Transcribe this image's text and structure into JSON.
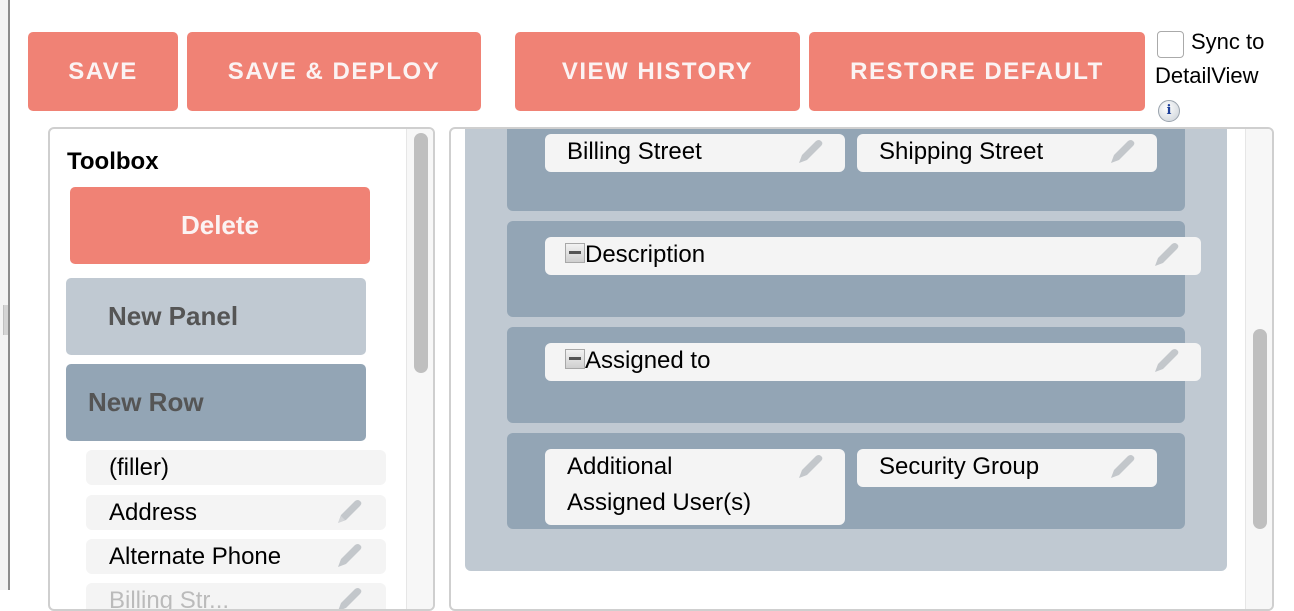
{
  "toolbar": {
    "save_label": "SAVE",
    "save_deploy_label": "SAVE & DEPLOY",
    "view_history_label": "VIEW HISTORY",
    "restore_default_label": "RESTORE DEFAULT",
    "sync_label_line1": "Sync to",
    "sync_label_line2": "DetailView",
    "sync_checked": false,
    "info_glyph": "i"
  },
  "colors": {
    "accent": "#f08275",
    "panel": "#c0c9d2",
    "row": "#93a5b5",
    "field": "#f4f4f4"
  },
  "toolbox": {
    "title": "Toolbox",
    "delete_label": "Delete",
    "new_panel_label": "New Panel",
    "new_row_label": "New Row",
    "fields": [
      {
        "label": "(filler)",
        "editable": false
      },
      {
        "label": "Address",
        "editable": true
      },
      {
        "label": "Alternate Phone",
        "editable": true
      },
      {
        "label": "Billing Str...",
        "editable": true
      }
    ]
  },
  "layout": {
    "rows": [
      {
        "fields": [
          {
            "label": "Billing Street"
          },
          {
            "label": "Shipping Street"
          }
        ]
      },
      {
        "fields": [
          {
            "label": "Description",
            "collapsible": true
          }
        ]
      },
      {
        "fields": [
          {
            "label": "Assigned to",
            "collapsible": true
          }
        ]
      },
      {
        "fields": [
          {
            "label": "Additional Assigned User(s)"
          },
          {
            "label": "Security Group"
          }
        ]
      }
    ]
  }
}
